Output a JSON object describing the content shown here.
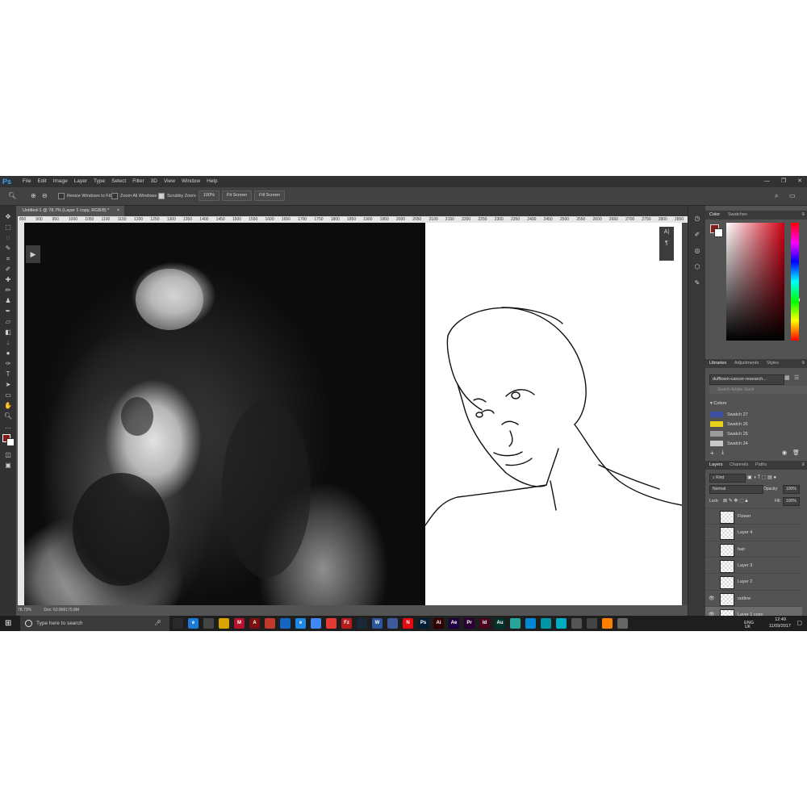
{
  "menubar": {
    "logo": "Ps",
    "items": [
      "File",
      "Edit",
      "Image",
      "Layer",
      "Type",
      "Select",
      "Filter",
      "3D",
      "View",
      "Window",
      "Help"
    ],
    "window_controls": [
      "—",
      "❐",
      "✕"
    ]
  },
  "options_bar": {
    "resize_windows_label": "Resize Windows to Fit",
    "zoom_all_label": "Zoom All Windows",
    "scrubby_zoom_label": "Scrubby Zoom",
    "zoom_value": "100%",
    "fit_screen_label": "Fit Screen",
    "fill_screen_label": "Fill Screen"
  },
  "document": {
    "tab_title": "Untitled-1 @ 78.7% (Layer 1 copy, RGB/8) *",
    "tab_close": "×",
    "zoom_status": "78.73%",
    "doc_status": "Doc: 63.8M/175.8M"
  },
  "ruler_ticks": [
    "850",
    "900",
    "950",
    "1000",
    "1050",
    "1100",
    "1150",
    "1200",
    "1250",
    "1300",
    "1350",
    "1400",
    "1450",
    "1500",
    "1550",
    "1600",
    "1650",
    "1700",
    "1750",
    "1800",
    "1850",
    "1900",
    "1950",
    "2000",
    "2050",
    "2100",
    "2150",
    "2200",
    "2250",
    "2300",
    "2350",
    "2400",
    "2450",
    "2500",
    "2550",
    "2600",
    "2650",
    "2700",
    "2750",
    "2800",
    "2850"
  ],
  "color_panel": {
    "tabs": [
      "Color",
      "Swatches"
    ],
    "foreground": "#8b1a1a",
    "background": "#ffffff"
  },
  "libraries_panel": {
    "tabs": [
      "Libraries",
      "Adjustments",
      "Styles"
    ],
    "library_name": "dufftown-cancer-research...",
    "search_placeholder": "Search Adobe Stock",
    "colors_header": "Colors",
    "swatches": [
      {
        "name": "Swatch 27",
        "color": "#3a4fa0"
      },
      {
        "name": "Swatch 26",
        "color": "#e8d11a"
      },
      {
        "name": "Swatch 25",
        "color": "#9c9c9c"
      },
      {
        "name": "Swatch 24",
        "color": "#c9c9c9"
      }
    ]
  },
  "layers_panel": {
    "tabs": [
      "Layers",
      "Channels",
      "Paths"
    ],
    "kind_filter": "Kind",
    "blend_mode": "Normal",
    "opacity_label": "Opacity:",
    "opacity_value": "100%",
    "lock_label": "Lock:",
    "fill_label": "Fill:",
    "fill_value": "100%",
    "layers": [
      {
        "name": "Flower",
        "visible": false
      },
      {
        "name": "Layer 4",
        "visible": false
      },
      {
        "name": "hair",
        "visible": false
      },
      {
        "name": "Layer 3",
        "visible": false
      },
      {
        "name": "Layer 2",
        "visible": false
      },
      {
        "name": "outline",
        "visible": true
      },
      {
        "name": "Layer 1 copy",
        "visible": true
      }
    ]
  },
  "canvas_panel": {
    "type_icon": "A|",
    "para_icon": "¶"
  },
  "taskbar": {
    "search_placeholder": "Type here to search",
    "lang": "ENG",
    "region": "UK",
    "time": "12:49",
    "date": "11/09/2017",
    "apps": [
      {
        "label": "",
        "color": "#2a2a2a"
      },
      {
        "label": "e",
        "color": "#1e78d6"
      },
      {
        "label": "",
        "color": "#444"
      },
      {
        "label": "",
        "color": "#d8a400"
      },
      {
        "label": "M",
        "color": "#b5122b"
      },
      {
        "label": "A",
        "color": "#7a1010"
      },
      {
        "label": "",
        "color": "#c0392b"
      },
      {
        "label": "",
        "color": "#1565c0"
      },
      {
        "label": "e",
        "color": "#1e88e5"
      },
      {
        "label": "",
        "color": "#4285f4"
      },
      {
        "label": "",
        "color": "#e53935"
      },
      {
        "label": "Fz",
        "color": "#b71c1c"
      },
      {
        "label": "",
        "color": "#1b2838"
      },
      {
        "label": "W",
        "color": "#2b579a"
      },
      {
        "label": "",
        "color": "#3c5a99"
      },
      {
        "label": "N",
        "color": "#e50914"
      },
      {
        "label": "Ps",
        "color": "#001e36"
      },
      {
        "label": "Ai",
        "color": "#330000"
      },
      {
        "label": "Ae",
        "color": "#1f0040"
      },
      {
        "label": "Pr",
        "color": "#2a0034"
      },
      {
        "label": "Id",
        "color": "#49021f"
      },
      {
        "label": "Au",
        "color": "#00332b"
      },
      {
        "label": "",
        "color": "#26a69a"
      },
      {
        "label": "",
        "color": "#0288d1"
      },
      {
        "label": "",
        "color": "#0097a7"
      },
      {
        "label": "",
        "color": "#00acc1"
      },
      {
        "label": "",
        "color": "#555"
      },
      {
        "label": "",
        "color": "#444"
      },
      {
        "label": "",
        "color": "#ff7f00"
      },
      {
        "label": "",
        "color": "#666"
      }
    ]
  }
}
